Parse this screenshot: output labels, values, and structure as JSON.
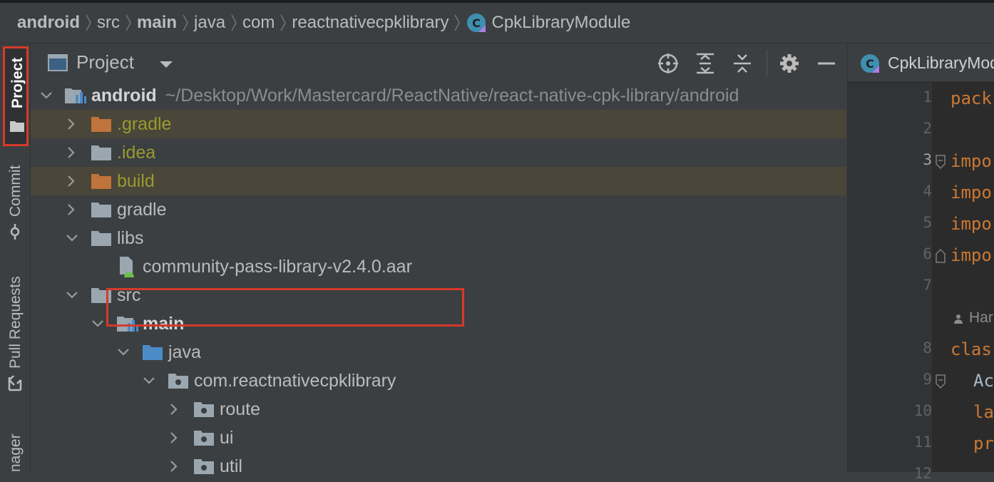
{
  "breadcrumb": [
    {
      "label": "android",
      "bold": true
    },
    {
      "label": "src",
      "bold": false
    },
    {
      "label": "main",
      "bold": true
    },
    {
      "label": "java",
      "bold": false
    },
    {
      "label": "com",
      "bold": false
    },
    {
      "label": "reactnativecpklibrary",
      "bold": false
    },
    {
      "label": "CpkLibraryModule",
      "bold": false,
      "icon": "kotlin-class-icon"
    }
  ],
  "left_strip": {
    "project": "Project",
    "commit": "Commit",
    "pull_requests": "Pull Requests",
    "manager": "nager"
  },
  "project_panel": {
    "title": "Project",
    "tools": [
      "locate-icon",
      "expand-all-icon",
      "collapse-all-icon",
      "gear-icon",
      "minimize-icon"
    ]
  },
  "tree": {
    "root": {
      "label": "android",
      "path": "~/Desktop/Work/Mastercard/ReactNative/react-native-cpk-library/android"
    },
    "gradle_hidden": ".gradle",
    "idea": ".idea",
    "build": "build",
    "gradle": "gradle",
    "libs": "libs",
    "aar_file": "community-pass-library-v2.4.0.aar",
    "src": "src",
    "main": "main",
    "java": "java",
    "package": "com.reactnativecpklibrary",
    "route": "route",
    "ui": "ui",
    "util": "util"
  },
  "editor": {
    "tab": "CpkLibraryModule",
    "line_numbers": [
      "1",
      "2",
      "3",
      "4",
      "5",
      "6",
      "7",
      "8",
      "9",
      "10",
      "11",
      "12"
    ],
    "current_line": "3",
    "lines": [
      "pack",
      "impo",
      "impo",
      "impo",
      "impo",
      "clas",
      "Ac",
      "la",
      "pr"
    ],
    "author": "Har"
  },
  "colors": {
    "accent_red": "#d63a2b",
    "excluded_bg": "#4a4639",
    "olive_text": "#9a9a2e"
  }
}
